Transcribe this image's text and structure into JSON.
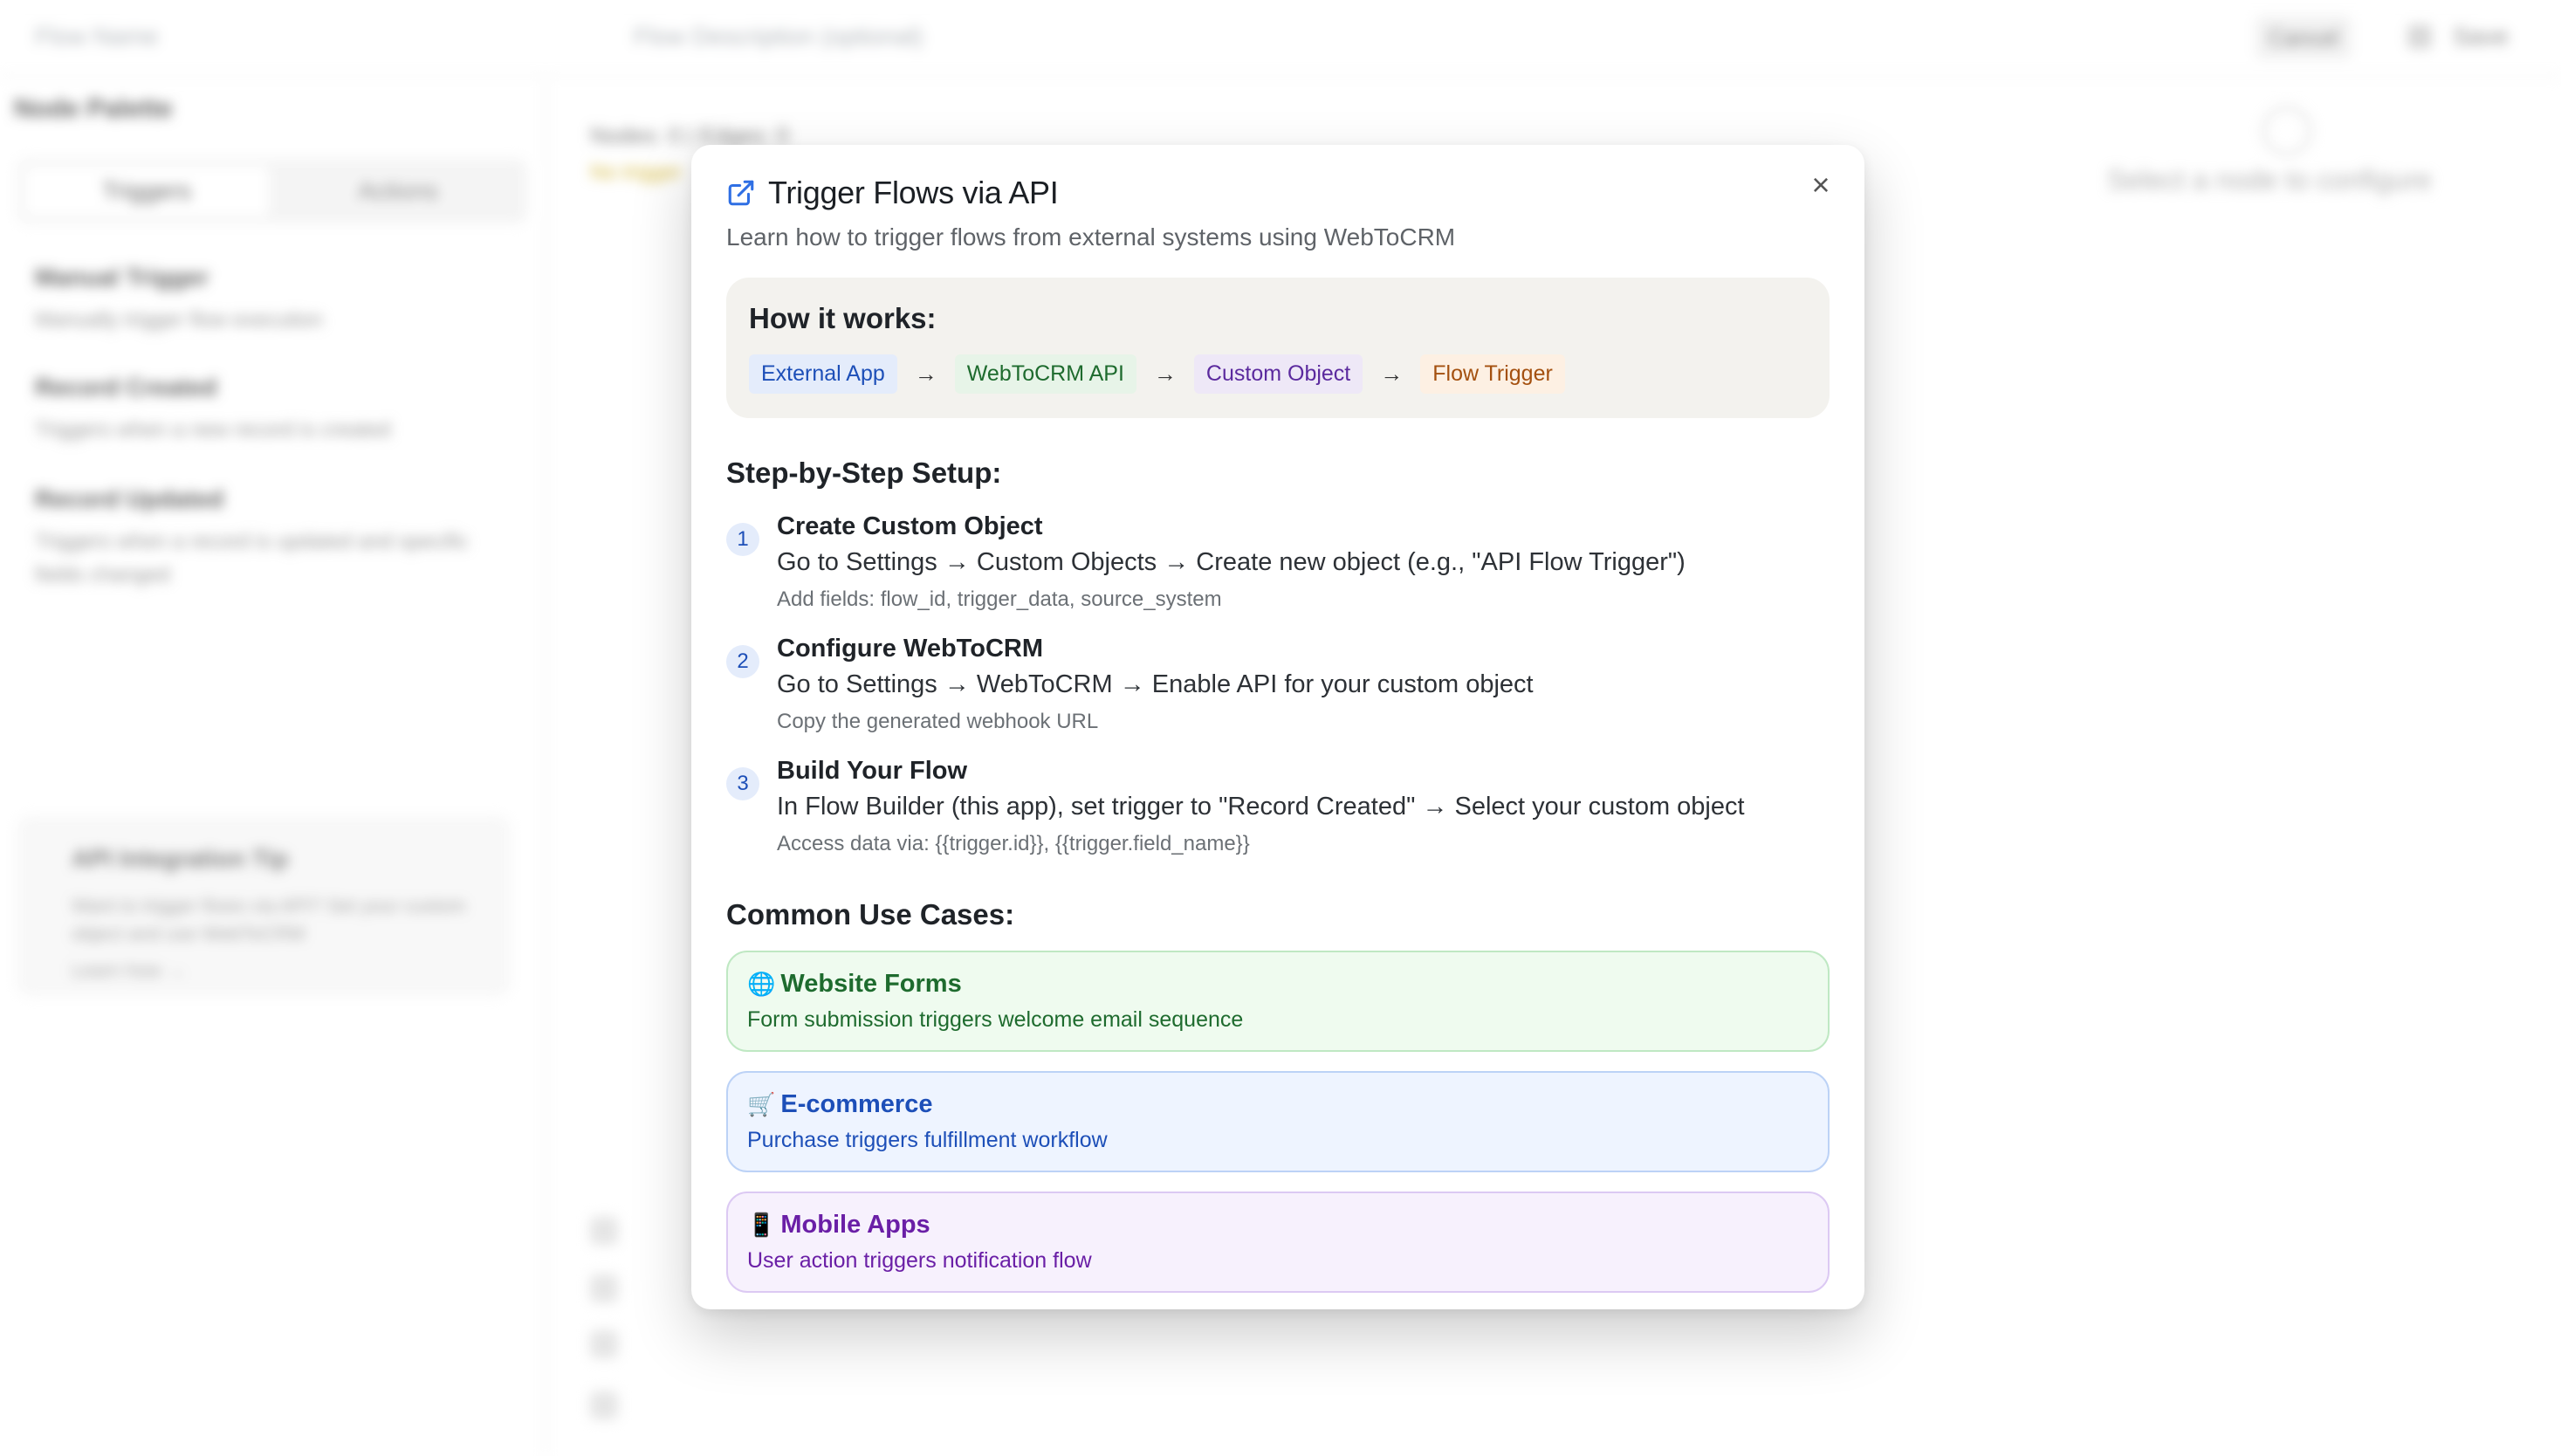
{
  "background": {
    "header": {
      "flow_name_placeholder": "Flow Name",
      "flow_desc_placeholder": "Flow Description (optional)",
      "cancel_label": "Cancel",
      "save_label": "Save"
    },
    "palette": {
      "title": "Node Palette",
      "tabs": [
        {
          "label": "Triggers"
        },
        {
          "label": "Actions"
        }
      ],
      "nodes": [
        {
          "title": "Manual Trigger",
          "desc": "Manually trigger flow execution"
        },
        {
          "title": "Record Created",
          "desc": "Triggers when a new record is created"
        },
        {
          "title": "Record Updated",
          "desc": "Triggers when a record is updated and specific fields changed"
        }
      ],
      "tip": {
        "title": "API Integration Tip",
        "body": "Want to trigger flows via API? Set your custom object and use WebToCRM",
        "link": "Learn how →"
      }
    },
    "canvas": {
      "status": "Nodes: 0 | Edges: 0",
      "warning": "No trigger"
    },
    "config": {
      "empty_text": "Select a node to configure"
    }
  },
  "modal": {
    "title": "Trigger Flows via API",
    "subtitle": "Learn how to trigger flows from external systems using WebToCRM",
    "how": {
      "title": "How it works:",
      "chips": [
        "External App",
        "WebToCRM API",
        "Custom Object",
        "Flow Trigger"
      ],
      "arrow": "→"
    },
    "steps_title": "Step-by-Step Setup:",
    "steps": [
      {
        "num": "1",
        "title": "Create Custom Object",
        "desc": "Go to Settings → Custom Objects → Create new object (e.g., \"API Flow Trigger\")",
        "note": "Add fields: flow_id, trigger_data, source_system"
      },
      {
        "num": "2",
        "title": "Configure WebToCRM",
        "desc": "Go to Settings → WebToCRM → Enable API for your custom object",
        "note": "Copy the generated webhook URL"
      },
      {
        "num": "3",
        "title": "Build Your Flow",
        "desc": "In Flow Builder (this app), set trigger to \"Record Created\" → Select your custom object",
        "note": "Access data via: {{trigger.id}}, {{trigger.field_name}}"
      }
    ],
    "uses_title": "Common Use Cases:",
    "uses": [
      {
        "icon": "🌐",
        "title": "Website Forms",
        "desc": "Form submission triggers welcome email sequence"
      },
      {
        "icon": "🛒",
        "title": "E-commerce",
        "desc": "Purchase triggers fulfillment workflow"
      },
      {
        "icon": "📱",
        "title": "Mobile Apps",
        "desc": "User action triggers notification flow"
      }
    ],
    "close_glyph": "×"
  }
}
